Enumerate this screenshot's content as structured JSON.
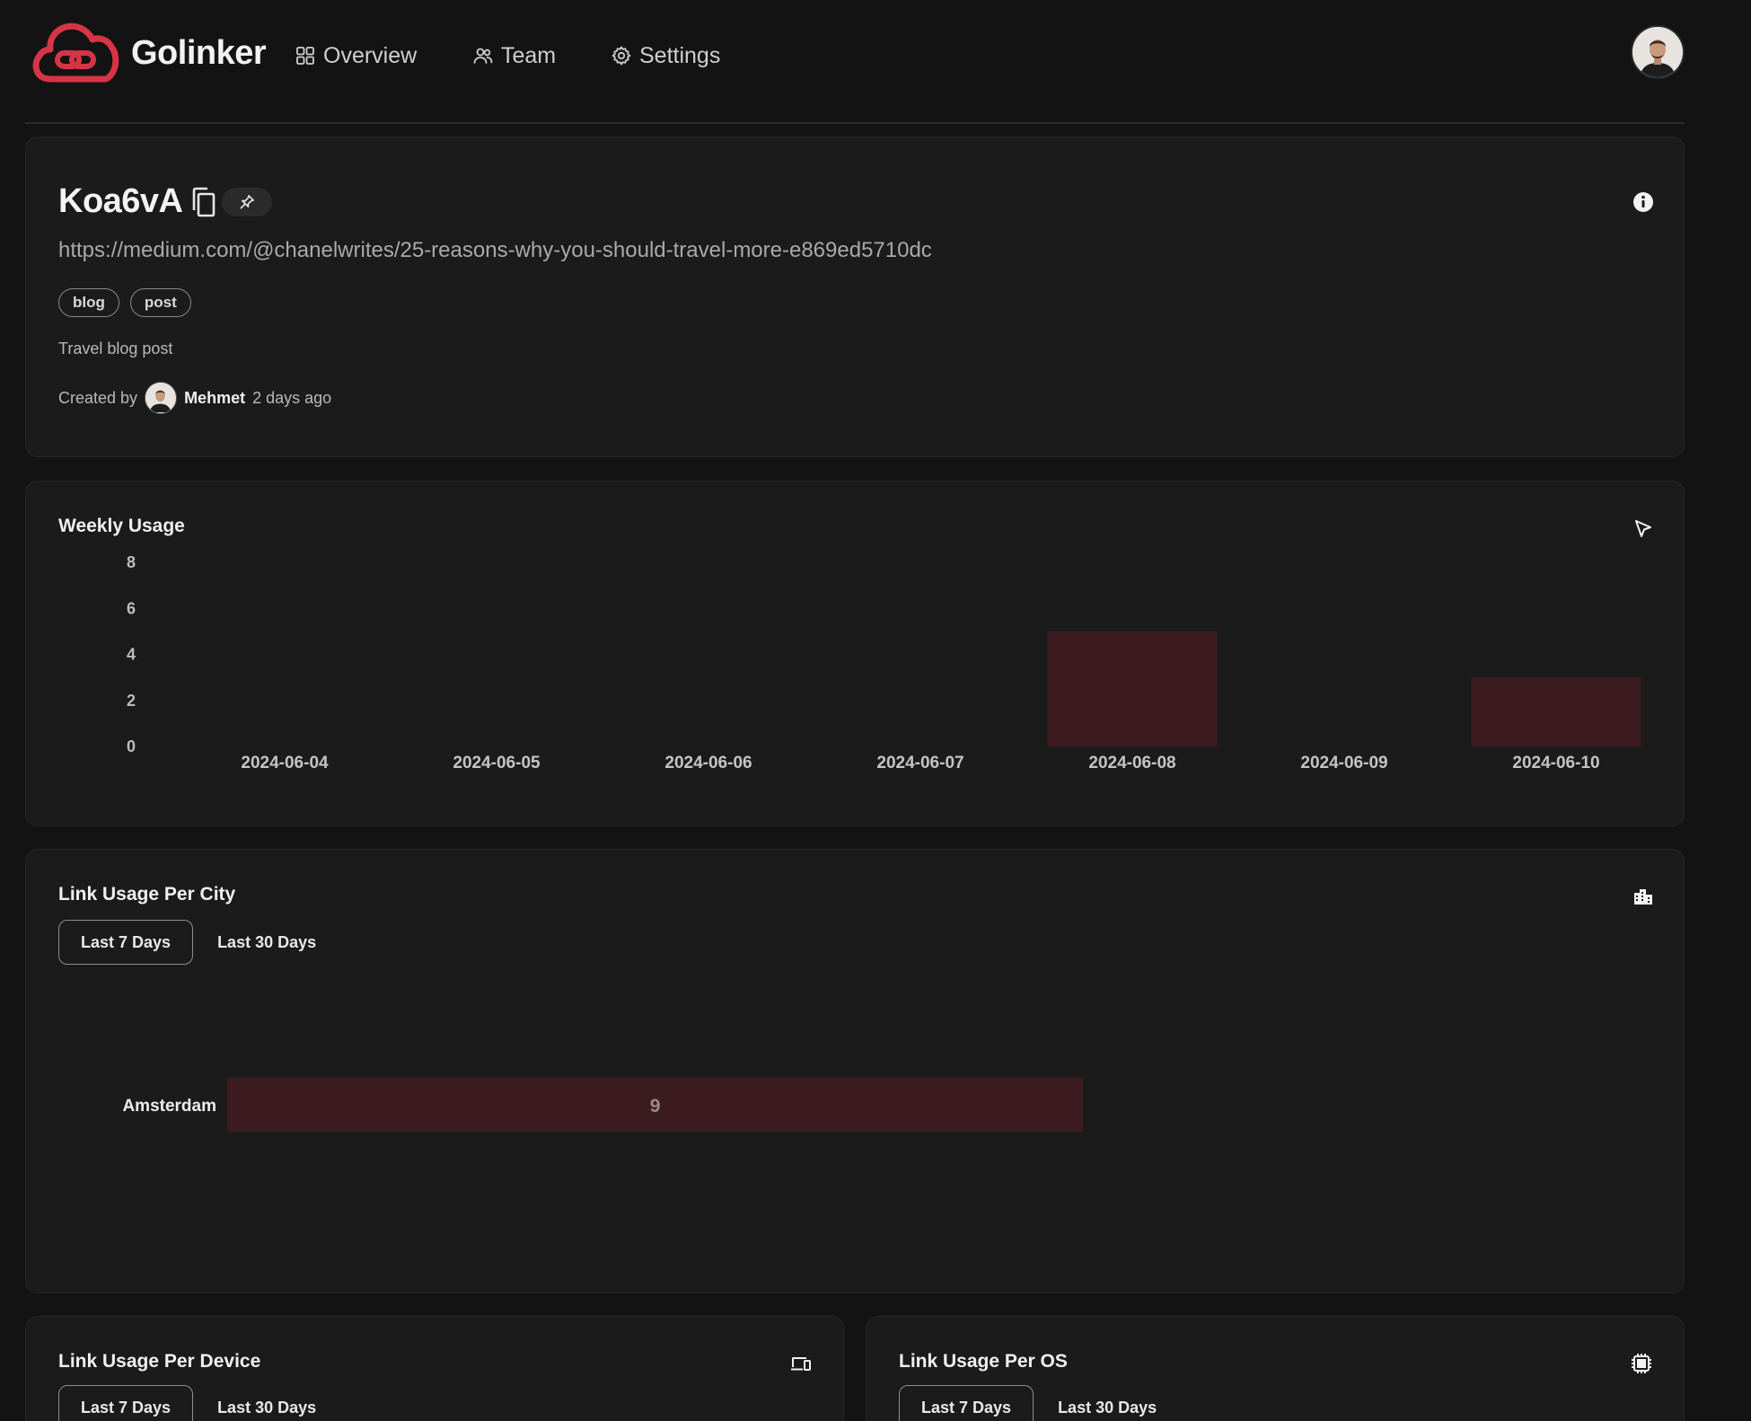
{
  "app": {
    "name": "Golinker",
    "brand_color": "#d63546"
  },
  "nav": [
    {
      "label": "Overview",
      "icon": "grid-icon"
    },
    {
      "label": "Team",
      "icon": "users-icon"
    },
    {
      "label": "Settings",
      "icon": "gear-icon"
    }
  ],
  "link": {
    "slug": "Koa6vA",
    "url": "https://medium.com/@chanelwrites/25-reasons-why-you-should-travel-more-e869ed5710dc",
    "tags": [
      "blog",
      "post"
    ],
    "description": "Travel blog post",
    "created_prefix": "Created by",
    "creator": "Mehmet",
    "created_ago": "2 days ago"
  },
  "weekly": {
    "title": "Weekly Usage",
    "icon": "cursor-icon"
  },
  "city": {
    "title": "Link Usage Per City",
    "icon": "building-icon",
    "tabs": [
      "Last 7 Days",
      "Last 30 Days"
    ],
    "active_tab": 0
  },
  "device": {
    "title": "Link Usage Per Device",
    "icon": "devices-icon",
    "tabs": [
      "Last 7 Days",
      "Last 30 Days"
    ],
    "active_tab": 0
  },
  "os": {
    "title": "Link Usage Per OS",
    "icon": "cpu-icon",
    "tabs": [
      "Last 7 Days",
      "Last 30 Days"
    ],
    "active_tab": 0
  },
  "bar_color": "#3c1c20",
  "chart_data": [
    {
      "type": "bar",
      "title": "Weekly Usage",
      "categories": [
        "2024-06-04",
        "2024-06-05",
        "2024-06-06",
        "2024-06-07",
        "2024-06-08",
        "2024-06-09",
        "2024-06-10"
      ],
      "values": [
        0,
        0,
        0,
        0,
        5,
        0,
        3
      ],
      "yticks": [
        0,
        2,
        4,
        6,
        8
      ],
      "ylim": [
        0,
        8
      ],
      "xlabel": "",
      "ylabel": "",
      "grid": false
    },
    {
      "type": "bar",
      "orientation": "horizontal",
      "title": "Link Usage Per City",
      "categories": [
        "Amsterdam"
      ],
      "values": [
        9
      ],
      "data_labels": [
        "9"
      ],
      "grid": false
    }
  ]
}
